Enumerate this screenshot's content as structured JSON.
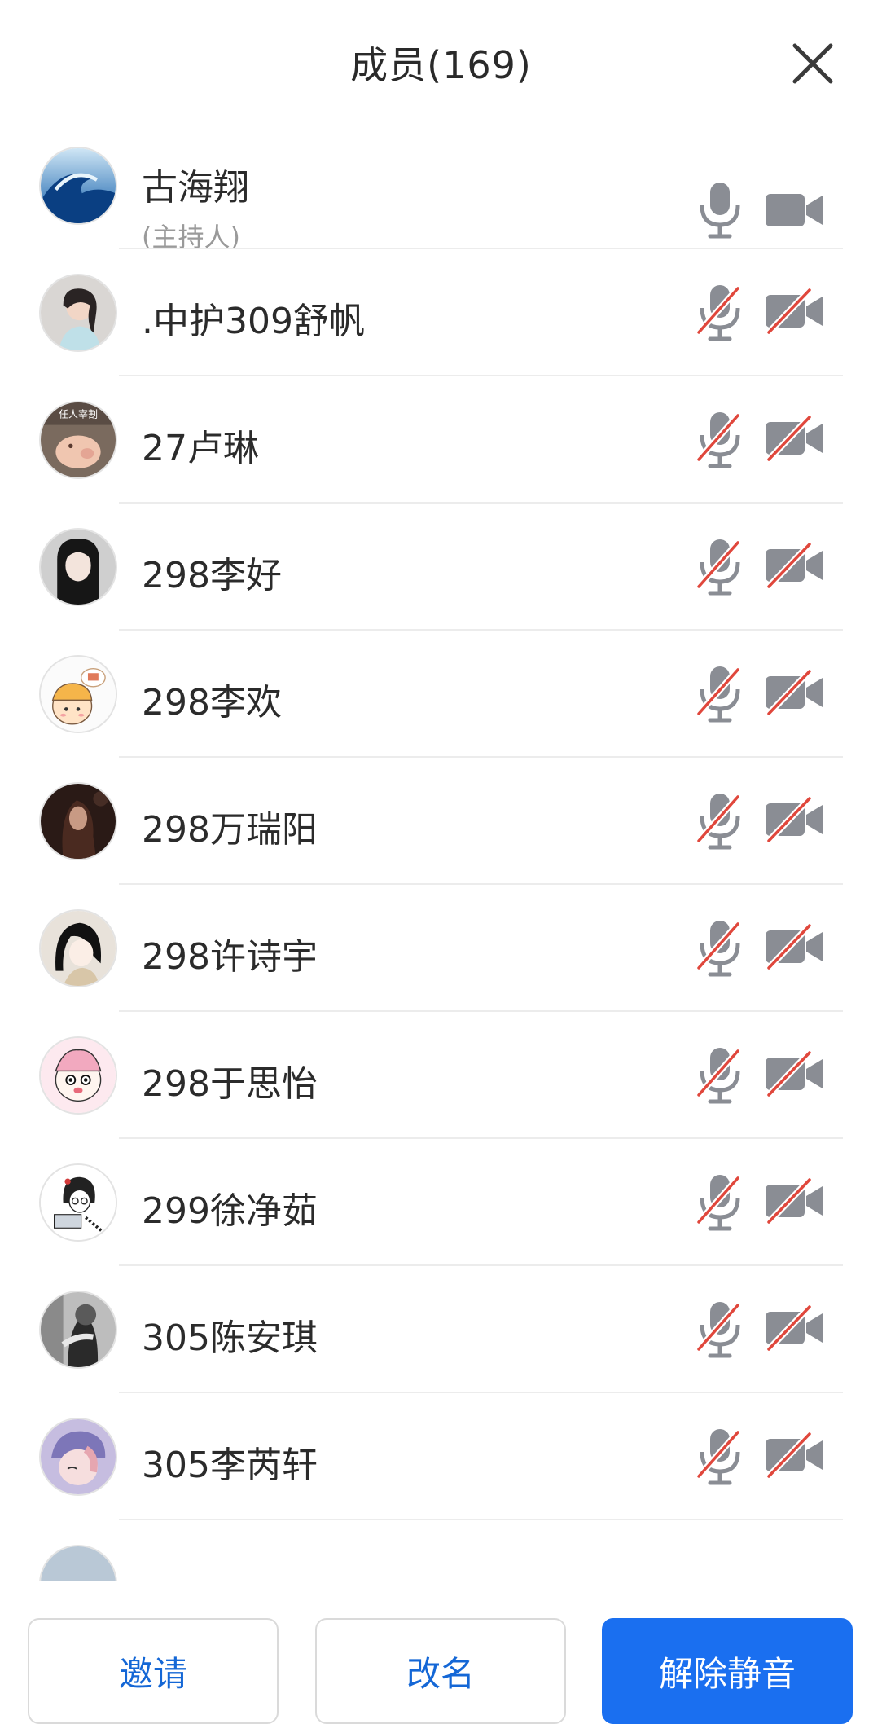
{
  "header": {
    "title": "成员(169)",
    "close_icon": "close-icon"
  },
  "members": [
    {
      "name": "古海翔",
      "role": "(主持人)",
      "mic_muted": false,
      "cam_off": false,
      "avatar": "wave"
    },
    {
      "name": ".中护309舒帆",
      "mic_muted": true,
      "cam_off": true,
      "avatar": "girl-light"
    },
    {
      "name": "27卢琳",
      "mic_muted": true,
      "cam_off": true,
      "avatar": "pig",
      "avatar_text": "任人宰割"
    },
    {
      "name": "298李好",
      "mic_muted": true,
      "cam_off": true,
      "avatar": "girl-dark"
    },
    {
      "name": "298李欢",
      "mic_muted": true,
      "cam_off": true,
      "avatar": "cartoon-kid"
    },
    {
      "name": "298万瑞阳",
      "mic_muted": true,
      "cam_off": true,
      "avatar": "dark-photo"
    },
    {
      "name": "298许诗宇",
      "mic_muted": true,
      "cam_off": true,
      "avatar": "anime-girl"
    },
    {
      "name": "298于思怡",
      "mic_muted": true,
      "cam_off": true,
      "avatar": "pink-cartoon"
    },
    {
      "name": "299徐净茹",
      "mic_muted": true,
      "cam_off": true,
      "avatar": "sketch-girl"
    },
    {
      "name": "305陈安琪",
      "mic_muted": true,
      "cam_off": true,
      "avatar": "bw-photo"
    },
    {
      "name": "305李芮轩",
      "mic_muted": true,
      "cam_off": true,
      "avatar": "purple-cartoon"
    }
  ],
  "footer": {
    "invite_label": "邀请",
    "rename_label": "改名",
    "unmute_label": "解除静音"
  },
  "colors": {
    "accent": "#1a6ff0",
    "accent_text": "#1467d6",
    "muted_slash": "#e0473c",
    "icon_gray": "#8a8d94"
  }
}
